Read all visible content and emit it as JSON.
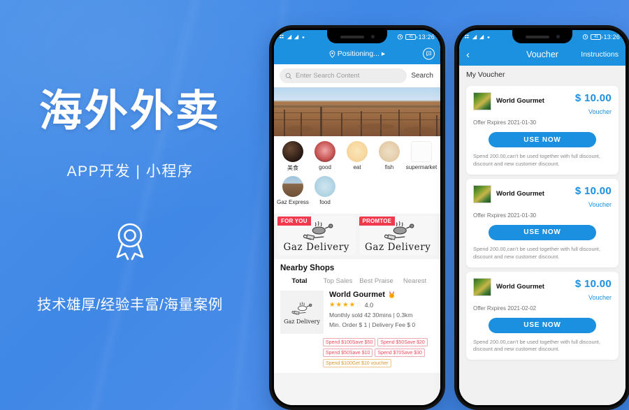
{
  "promo": {
    "headline": "海外外卖",
    "subhead": "APP开发 | 小程序",
    "tagline": "技术雄厚/经验丰富/海量案例",
    "medal_icon": "medal-icon",
    "bg_color": "#4088e6",
    "text_color": "#ffffff"
  },
  "phone_left": {
    "status": {
      "time": "13:26",
      "alarm_icon": "alarm-icon",
      "battery_icon": "battery-icon",
      "signal_icon": "signal-icon",
      "wifi_icon": "wifi-icon"
    },
    "topbar": {
      "location_icon": "location-pin-icon",
      "location_text": "Positioning...",
      "arrow": "▸",
      "chat_icon": "chat-bubble-icon"
    },
    "search": {
      "icon": "search-icon",
      "placeholder": "Enter Search Content",
      "button_label": "Search"
    },
    "hero_alt": "vineyard-banner",
    "categories": [
      {
        "label": "美食",
        "icon": "food-category-icon",
        "style": "ci-food"
      },
      {
        "label": "good",
        "icon": "meat-category-icon",
        "style": "ci-good"
      },
      {
        "label": "eat",
        "icon": "fruit-category-icon",
        "style": "ci-eat"
      },
      {
        "label": "fish",
        "icon": "fish-category-icon",
        "style": "ci-fish"
      },
      {
        "label": "supermarket",
        "icon": "supermarket-category-icon",
        "style": "ci-super"
      },
      {
        "label": "Gaz Express",
        "icon": "express-category-icon",
        "style": "ci-gaz"
      },
      {
        "label": "food",
        "icon": "food2-category-icon",
        "style": "ci-food2"
      }
    ],
    "banners": [
      {
        "tag": "FOR YOU",
        "title": "Gaz Delivery"
      },
      {
        "tag": "PROMTOE",
        "title": "Gaz Delivery"
      }
    ],
    "nearby": {
      "heading": "Nearby Shops",
      "tabs": [
        {
          "label": "Total",
          "active": true
        },
        {
          "label": "Top Sales",
          "active": false
        },
        {
          "label": "Best Praise",
          "active": false
        },
        {
          "label": "Nearest",
          "active": false
        }
      ]
    },
    "shop": {
      "thumb_title": "Gaz Delivery",
      "name": "World Gourmet",
      "badge_icon": "medal-badge-icon",
      "rating": "4.0",
      "stars_filled": 4,
      "stars_total": 5,
      "meta_line1": "Monthly sold 42   30mins | 0.3km",
      "meta_line2": "Min. Order $ 1 | Delivery Fee $ 0",
      "promos": [
        {
          "text": "Spend $100Save $50",
          "kind": "red"
        },
        {
          "text": "Spend $50Save $20",
          "kind": "red"
        },
        {
          "text": "Spend $50Save $10",
          "kind": "red"
        },
        {
          "text": "Spend $70Save $30",
          "kind": "red"
        },
        {
          "text": "Spend $100Get $10 voucher",
          "kind": "gold"
        }
      ]
    }
  },
  "phone_right": {
    "status": {
      "time": "13:26"
    },
    "navbar": {
      "back_icon": "back-chevron-icon",
      "title": "Voucher",
      "action_label": "Instructions"
    },
    "section_title": "My Voucher",
    "vouchers": [
      {
        "shop": "World Gourmet",
        "thumb_alt": "shop-thumbnail",
        "amount": "$ 10.00",
        "type_label": "Voucher",
        "expiry": "Offer Rxpires 2021-01-30",
        "button_label": "USE NOW",
        "terms": "Spend 200.00,can't be used together with full discount, discount and new customer discount."
      },
      {
        "shop": "World Gourmet",
        "thumb_alt": "shop-thumbnail",
        "amount": "$ 10.00",
        "type_label": "Voucher",
        "expiry": "Offer Rxpires 2021-01-30",
        "button_label": "USE NOW",
        "terms": "Spend 200.00,can't be used together with full discount, discount and new customer discount."
      },
      {
        "shop": "World Gourmet",
        "thumb_alt": "shop-thumbnail",
        "amount": "$ 10.00",
        "type_label": "Voucher",
        "expiry": "Offer Rxpires 2021-02-02",
        "button_label": "USE NOW",
        "terms": "Spend 200.00,can't be used together with full discount, discount and new customer discount."
      }
    ]
  }
}
